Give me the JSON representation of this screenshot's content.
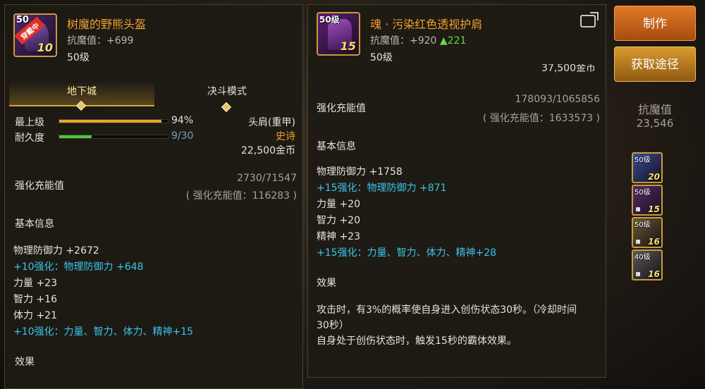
{
  "left": {
    "equipped_tag": "穿戴中",
    "icon_level": "50",
    "icon_plus": "10",
    "name": "树魔的野熊头盔",
    "resist": "抗魔值：+699",
    "level": "50级",
    "tabs": [
      "地下城",
      "决斗模式"
    ],
    "top_level_label": "最上级",
    "top_level_value": "94%",
    "top_level_fraction": 0.94,
    "durability_label": "耐久度",
    "durability_value": "9/30",
    "durability_fraction": 0.3,
    "slot": "头肩(重甲)",
    "rarity": "史诗",
    "price": "22,500金币",
    "charge_label": "强化充能值",
    "charge_ratio": "2730/71547",
    "charge_total": "( 强化充能值：116283 )",
    "basic_info_label": "基本信息",
    "stats": [
      "物理防御力 +2672",
      "+10强化：物理防御力 +648",
      "力量 +23",
      "智力 +16",
      "体力 +21",
      "+10强化：力量、智力、体力、精神+15"
    ],
    "effect_label": "效果"
  },
  "right": {
    "icon_level": "50级",
    "icon_plus": "15",
    "name": "魂 · 污染红色透视护肩",
    "resist_prefix": "抗魔值：+920 ",
    "resist_up": "▲221",
    "level": "50级",
    "price_partial": "37,500金币",
    "charge_label": "强化充能值",
    "charge_ratio": "178093/1065856",
    "charge_total": "( 强化充能值：1633573 )",
    "basic_info_label": "基本信息",
    "stats": [
      "物理防御力 +1758",
      "+15强化：物理防御力 +871",
      "力量 +20",
      "智力 +20",
      "精神 +23",
      "+15强化：力量、智力、体力、精神+28"
    ],
    "effect_label": "效果",
    "effect_text_1": "攻击时，有3%的概率使自身进入创伤状态30秒。（冷却时间",
    "effect_text_2": "30秒）",
    "effect_text_3": "自身处于创伤状态时，触发15秒的霸体效果。"
  },
  "side": {
    "make_label": "制作",
    "source_label": "获取途径",
    "resist_label": "抗魔值",
    "resist_value": "23,546",
    "thumbs": [
      {
        "level": "50级",
        "plus": "20",
        "color": "#3a4c9a"
      },
      {
        "level": "50级",
        "plus": "15",
        "color": "#5a2a6a"
      },
      {
        "level": "50级",
        "plus": "16",
        "color": "#6a5a30"
      },
      {
        "level": "40级",
        "plus": "16",
        "color": "#5a5a5a"
      }
    ]
  },
  "colors": {
    "accent": "#f0a030",
    "enhance": "#39c3e8",
    "bar_top": "#e8a52a",
    "bar_durability": "#4cc83a"
  }
}
